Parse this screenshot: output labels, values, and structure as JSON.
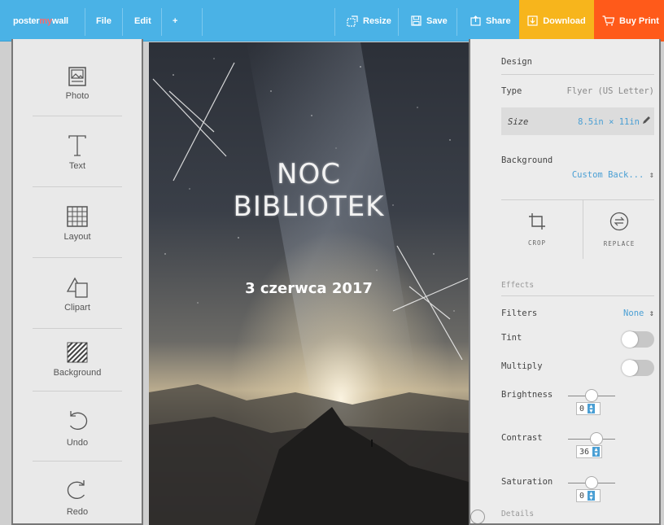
{
  "topbar": {
    "logo_poster": "poster",
    "logo_my": "my",
    "logo_wall": "wall",
    "file": "File",
    "edit": "Edit",
    "add": "+",
    "resize": "Resize",
    "save": "Save",
    "share": "Share",
    "download": "Download",
    "buy_print": "Buy Print"
  },
  "tools": [
    {
      "label": "Photo",
      "icon": "photo-icon"
    },
    {
      "label": "Text",
      "icon": "text-icon"
    },
    {
      "label": "Layout",
      "icon": "grid-icon"
    },
    {
      "label": "Clipart",
      "icon": "shapes-icon"
    },
    {
      "label": "Background",
      "icon": "hatch-icon"
    },
    {
      "label": "Undo",
      "icon": "undo-icon"
    },
    {
      "label": "Redo",
      "icon": "redo-icon"
    }
  ],
  "poster": {
    "title_line1": "NOC",
    "title_line2": "BIBLIOTEK",
    "date": "3 czerwca 2017"
  },
  "design": {
    "heading": "Design",
    "type_label": "Type",
    "type_value": "Flyer (US Letter)",
    "size_label": "Size",
    "size_value": "8.5in × 11in",
    "background_label": "Background",
    "background_value": "Custom Back...",
    "crop_label": "CROP",
    "replace_label": "REPLACE",
    "effects_heading": "Effects",
    "filters_label": "Filters",
    "filters_value": "None",
    "tint_label": "Tint",
    "tint_on": false,
    "multiply_label": "Multiply",
    "multiply_on": false,
    "brightness_label": "Brightness",
    "brightness_value": "0",
    "contrast_label": "Contrast",
    "contrast_value": "36",
    "saturation_label": "Saturation",
    "saturation_value": "0",
    "details_heading": "Details"
  },
  "colors": {
    "topbar": "#4ab2e6",
    "download": "#f7b51c",
    "buy_print": "#ff5a1a",
    "accent_blue": "#4a9fd4"
  }
}
